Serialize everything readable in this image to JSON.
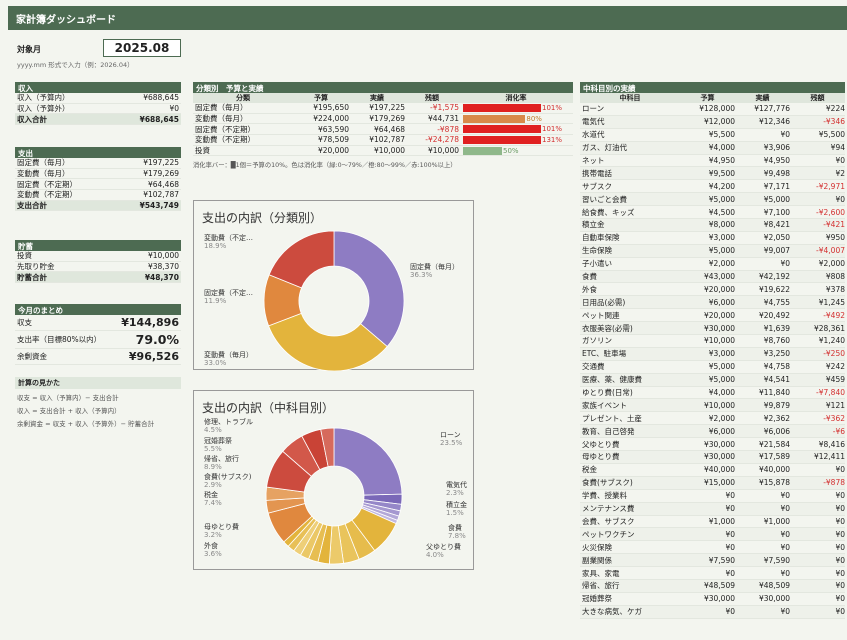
{
  "title": "家計簿ダッシュボード",
  "target": {
    "label": "対象月",
    "value": "2025.08",
    "hint": "yyyy.mm 形式で入力（例：2026.04）"
  },
  "income": {
    "header": "収入",
    "rows": [
      [
        "収入（予算内）",
        "¥688,645"
      ],
      [
        "収入（予算外）",
        "¥0"
      ]
    ],
    "total": [
      "収入合計",
      "¥688,645"
    ]
  },
  "expense": {
    "header": "支出",
    "rows": [
      [
        "固定費（毎月）",
        "¥197,225"
      ],
      [
        "変動費（毎月）",
        "¥179,269"
      ],
      [
        "固定費（不定期）",
        "¥64,468"
      ],
      [
        "変動費（不定期）",
        "¥102,787"
      ]
    ],
    "total": [
      "支出合計",
      "¥543,749"
    ]
  },
  "savings": {
    "header": "貯蓄",
    "rows": [
      [
        "投資",
        "¥10,000"
      ],
      [
        "先取り貯金",
        "¥38,370"
      ]
    ],
    "total": [
      "貯蓄合計",
      "¥48,370"
    ]
  },
  "summary": {
    "header": "今月のまとめ",
    "rows": [
      [
        "収支",
        "¥144,896"
      ],
      [
        "支出率（目標80%以内）",
        "79.0%"
      ],
      [
        "余剰資金",
        "¥96,526"
      ]
    ]
  },
  "formula": {
    "header": "計算の見かた",
    "lines": [
      "収支 = 収入（予算内）− 支出合計",
      "収入 = 支出合計 + 収入（予算内）",
      "余剰資金 = 収支 + 収入（予算外）− 貯蓄合計"
    ]
  },
  "category": {
    "header": "分類別　予算と実績",
    "cols": [
      "分類",
      "予算",
      "実績",
      "残額",
      "消化率"
    ],
    "rows": [
      {
        "name": "固定費（毎月）",
        "budget": "¥195,650",
        "actual": "¥197,225",
        "rest": "-¥1,575",
        "pct": "101%",
        "ratio": 1.0,
        "color": "#e02020",
        "neg": true
      },
      {
        "name": "変動費（毎月）",
        "budget": "¥224,000",
        "actual": "¥179,269",
        "rest": "¥44,731",
        "pct": "80%",
        "ratio": 0.8,
        "color": "#d8894a",
        "neg": false
      },
      {
        "name": "固定費（不定期）",
        "budget": "¥63,590",
        "actual": "¥64,468",
        "rest": "-¥878",
        "pct": "101%",
        "ratio": 1.0,
        "color": "#e02020",
        "neg": true
      },
      {
        "name": "変動費（不定期）",
        "budget": "¥78,509",
        "actual": "¥102,787",
        "rest": "-¥24,278",
        "pct": "131%",
        "ratio": 1.0,
        "color": "#e02020",
        "neg": true
      },
      {
        "name": "投資",
        "budget": "¥20,000",
        "actual": "¥10,000",
        "rest": "¥10,000",
        "pct": "50%",
        "ratio": 0.5,
        "color": "#8fb88a",
        "neg": false
      }
    ],
    "note": "消化率バー：█1個＝予算の10%。色は消化率（緑:0〜79%／橙:80〜99%／赤:100%以上）"
  },
  "chart1": {
    "title": "支出の内訳（分類別）",
    "labels": [
      [
        "変動費（不定…",
        "18.9%"
      ],
      [
        "固定費（毎月）",
        "36.3%"
      ],
      [
        "固定費（不定…",
        "11.9%"
      ],
      [
        "変動費（毎月）",
        "33.0%"
      ]
    ]
  },
  "chart2": {
    "title": "支出の内訳（中科目別）",
    "labels": [
      [
        "修理、トラブル",
        "4.5%"
      ],
      [
        "冠婚葬祭",
        "5.5%"
      ],
      [
        "帰省、旅行",
        "8.9%"
      ],
      [
        "食費(サブスク)",
        "2.9%"
      ],
      [
        "税金",
        "7.4%"
      ],
      [
        "母ゆとり費",
        "3.2%"
      ],
      [
        "外食",
        "3.6%"
      ],
      [
        "ローン",
        "23.5%"
      ],
      [
        "電気代",
        "2.3%"
      ],
      [
        "積立金",
        "1.5%"
      ],
      [
        "食費",
        "7.8%"
      ],
      [
        "父ゆとり費",
        "4.0%"
      ]
    ]
  },
  "chart_data": [
    {
      "type": "pie",
      "title": "支出の内訳（分類別）",
      "categories": [
        "固定費（毎月）",
        "変動費（毎月）",
        "固定費（不定期）",
        "変動費（不定期）"
      ],
      "values": [
        36.3,
        33.0,
        11.9,
        18.9
      ],
      "colors": [
        "#8e7cc3",
        "#e3b43c",
        "#e0883e",
        "#cc4b3e"
      ]
    },
    {
      "type": "pie",
      "title": "支出の内訳（中科目別）",
      "categories": [
        "ローン",
        "電気代",
        "積立金",
        "食費",
        "父ゆとり費",
        "外食",
        "母ゆとり費",
        "税金",
        "食費(サブスク)",
        "帰省、旅行",
        "冠婚葬祭",
        "修理、トラブル"
      ],
      "values": [
        23.5,
        2.3,
        1.5,
        7.8,
        4.0,
        3.6,
        3.2,
        7.4,
        2.9,
        8.9,
        5.5,
        4.5
      ]
    }
  ],
  "items": {
    "header": "中科目別の実績",
    "cols": [
      "中科目",
      "予算",
      "実績",
      "残額"
    ],
    "rows": [
      [
        "ローン",
        "¥128,000",
        "¥127,776",
        "¥224"
      ],
      [
        "電気代",
        "¥12,000",
        "¥12,346",
        "-¥346"
      ],
      [
        "水道代",
        "¥5,500",
        "¥0",
        "¥5,500"
      ],
      [
        "ガス、灯油代",
        "¥4,000",
        "¥3,906",
        "¥94"
      ],
      [
        "ネット",
        "¥4,950",
        "¥4,950",
        "¥0"
      ],
      [
        "携帯電話",
        "¥9,500",
        "¥9,498",
        "¥2"
      ],
      [
        "サブスク",
        "¥4,200",
        "¥7,171",
        "-¥2,971"
      ],
      [
        "習いごと会費",
        "¥5,000",
        "¥5,000",
        "¥0"
      ],
      [
        "給食費、キッズ",
        "¥4,500",
        "¥7,100",
        "-¥2,600"
      ],
      [
        "積立金",
        "¥8,000",
        "¥8,421",
        "-¥421"
      ],
      [
        "自動車保険",
        "¥3,000",
        "¥2,050",
        "¥950"
      ],
      [
        "生命保険",
        "¥5,000",
        "¥9,007",
        "-¥4,007"
      ],
      [
        "子小遣い",
        "¥2,000",
        "¥0",
        "¥2,000"
      ],
      [
        "食費",
        "¥43,000",
        "¥42,192",
        "¥808"
      ],
      [
        "外食",
        "¥20,000",
        "¥19,622",
        "¥378"
      ],
      [
        "日用品(必需)",
        "¥6,000",
        "¥4,755",
        "¥1,245"
      ],
      [
        "ペット関連",
        "¥20,000",
        "¥20,492",
        "-¥492"
      ],
      [
        "衣服美容(必需)",
        "¥30,000",
        "¥1,639",
        "¥28,361"
      ],
      [
        "ガソリン",
        "¥10,000",
        "¥8,760",
        "¥1,240"
      ],
      [
        "ETC、駐車場",
        "¥3,000",
        "¥3,250",
        "-¥250"
      ],
      [
        "交通費",
        "¥5,000",
        "¥4,758",
        "¥242"
      ],
      [
        "医療、薬、健康費",
        "¥5,000",
        "¥4,541",
        "¥459"
      ],
      [
        "ゆとり費(日常)",
        "¥4,000",
        "¥11,840",
        "-¥7,840"
      ],
      [
        "家族イベント",
        "¥10,000",
        "¥9,879",
        "¥121"
      ],
      [
        "プレゼント、土産",
        "¥2,000",
        "¥2,362",
        "-¥362"
      ],
      [
        "教育、自己啓発",
        "¥6,000",
        "¥6,006",
        "-¥6"
      ],
      [
        "父ゆとり費",
        "¥30,000",
        "¥21,584",
        "¥8,416"
      ],
      [
        "母ゆとり費",
        "¥30,000",
        "¥17,589",
        "¥12,411"
      ],
      [
        "税金",
        "¥40,000",
        "¥40,000",
        "¥0"
      ],
      [
        "食費(サブスク)",
        "¥15,000",
        "¥15,878",
        "-¥878"
      ],
      [
        "学費、授業料",
        "¥0",
        "¥0",
        "¥0"
      ],
      [
        "メンテナンス費",
        "¥0",
        "¥0",
        "¥0"
      ],
      [
        "会費、サブスク",
        "¥1,000",
        "¥1,000",
        "¥0"
      ],
      [
        "ペットワクチン",
        "¥0",
        "¥0",
        "¥0"
      ],
      [
        "火災保険",
        "¥0",
        "¥0",
        "¥0"
      ],
      [
        "副業関係",
        "¥7,590",
        "¥7,590",
        "¥0"
      ],
      [
        "家具、家電",
        "¥0",
        "¥0",
        "¥0"
      ],
      [
        "帰省、旅行",
        "¥48,509",
        "¥48,509",
        "¥0"
      ],
      [
        "冠婚葬祭",
        "¥30,000",
        "¥30,000",
        "¥0"
      ],
      [
        "大きな病気、ケガ",
        "¥0",
        "¥0",
        "¥0"
      ]
    ]
  }
}
